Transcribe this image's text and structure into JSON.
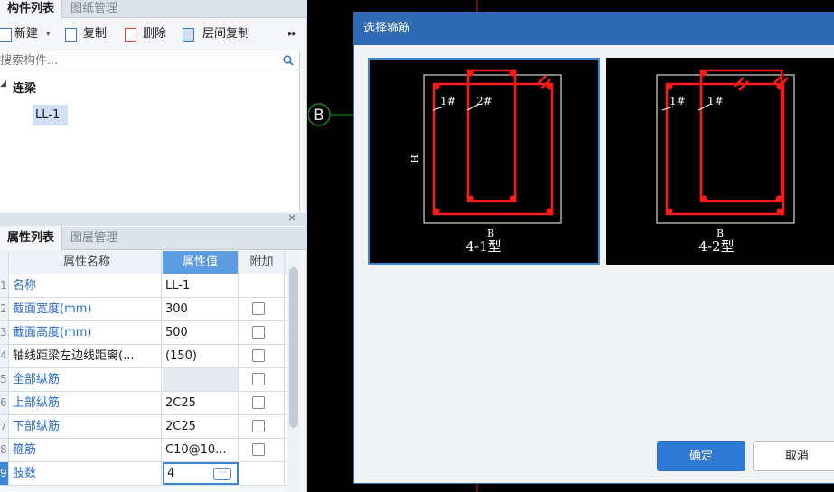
{
  "left_panel": {
    "top_tabs": [
      "构件列表",
      "图纸管理"
    ],
    "toolbar": {
      "new_label": "新建",
      "copy_label": "复制",
      "delete_label": "删除",
      "floor_copy_label": "层间复制",
      "more_glyph": "▸▸"
    },
    "search": {
      "placeholder": "搜索构件..."
    },
    "tree": {
      "group_label": "连梁",
      "leaf_label": "LL-1"
    },
    "bottom_tabs": [
      "属性列表",
      "图层管理"
    ],
    "properties": {
      "headers": {
        "name": "属性名称",
        "value": "属性值",
        "extra": "附加"
      },
      "rows": [
        {
          "index": "1",
          "name": "名称",
          "value": "LL-1",
          "has_checkbox": false,
          "name_color": "blue"
        },
        {
          "index": "2",
          "name": "截面宽度(mm)",
          "value": "300",
          "has_checkbox": true,
          "name_color": "blue"
        },
        {
          "index": "3",
          "name": "截面高度(mm)",
          "value": "500",
          "has_checkbox": true,
          "name_color": "blue"
        },
        {
          "index": "4",
          "name": "轴线距梁左边线距离(...",
          "value": "(150)",
          "has_checkbox": true,
          "name_color": "dark"
        },
        {
          "index": "5",
          "name": "全部纵筋",
          "value": "",
          "has_checkbox": true,
          "name_color": "blue"
        },
        {
          "index": "6",
          "name": "上部纵筋",
          "value": "2C25",
          "has_checkbox": true,
          "name_color": "blue"
        },
        {
          "index": "7",
          "name": "下部纵筋",
          "value": "2C25",
          "has_checkbox": true,
          "name_color": "blue"
        },
        {
          "index": "8",
          "name": "箍筋",
          "value": "C10@10...",
          "has_checkbox": true,
          "name_color": "blue"
        },
        {
          "index": "9",
          "name": "肢数",
          "value": "4",
          "has_checkbox": false,
          "name_color": "blue"
        }
      ]
    }
  },
  "canvas": {
    "axis_label": "B"
  },
  "dialog": {
    "title": "选择箍筋",
    "options": [
      {
        "caption": "4-1型",
        "h_label": "H",
        "b_label": "B",
        "left_tag": "1#",
        "right_tag": "2#"
      },
      {
        "caption": "4-2型",
        "h_label": "",
        "b_label": "B",
        "left_tag": "1#",
        "right_tag": "1#"
      }
    ],
    "ok_label": "确定",
    "cancel_label": "取消"
  },
  "colors": {
    "accent": "#2f6bb5",
    "rebar": "#ff1a1a",
    "canvas_bg": "#000000",
    "header_blue": "#5b9be0"
  }
}
